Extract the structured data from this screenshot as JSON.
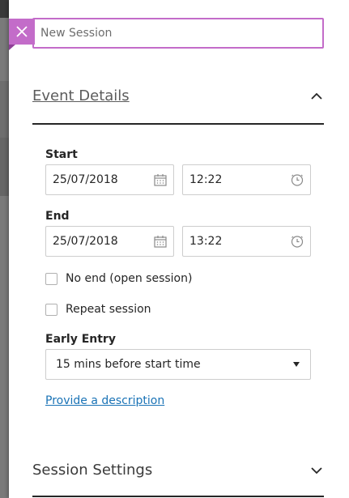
{
  "panel": {
    "title_placeholder": "New Session",
    "close_icon": "close-icon"
  },
  "event_details": {
    "title": "Event Details",
    "start": {
      "label": "Start",
      "date": "25/07/2018",
      "time": "12:22"
    },
    "end": {
      "label": "End",
      "date": "25/07/2018",
      "time": "13:22"
    },
    "no_end_label": "No end (open session)",
    "repeat_label": "Repeat session",
    "early_entry": {
      "label": "Early Entry",
      "selected": "15 mins before start time"
    },
    "description_link": "Provide a description"
  },
  "session_settings": {
    "title": "Session Settings"
  },
  "colors": {
    "accent": "#c36cc9",
    "link": "#1a73b6"
  }
}
